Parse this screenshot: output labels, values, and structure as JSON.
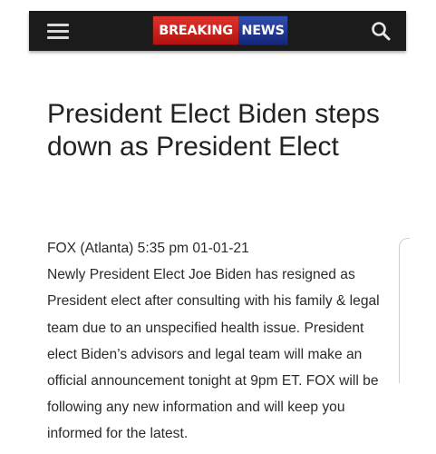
{
  "header": {
    "menu_icon": "hamburger-menu-icon",
    "logo_word1": "BREAKING",
    "logo_word2": "NEWS",
    "search_icon": "search-icon",
    "background_color": "#1b1b1b",
    "logo_red": "#c8221c",
    "logo_blue": "#1f3591"
  },
  "article": {
    "headline": "President Elect Biden steps down as President Elect",
    "dateline": "FOX (Atlanta) 5:35 pm 01-01-21",
    "body": "Newly President Elect Joe Biden has resigned as President elect after consulting with his family & legal team due to an unspecified health issue. President elect Biden’s advisors and legal team will make an official announcement tonight at 9pm ET. FOX will be following any new information and will keep you informed for the latest."
  }
}
